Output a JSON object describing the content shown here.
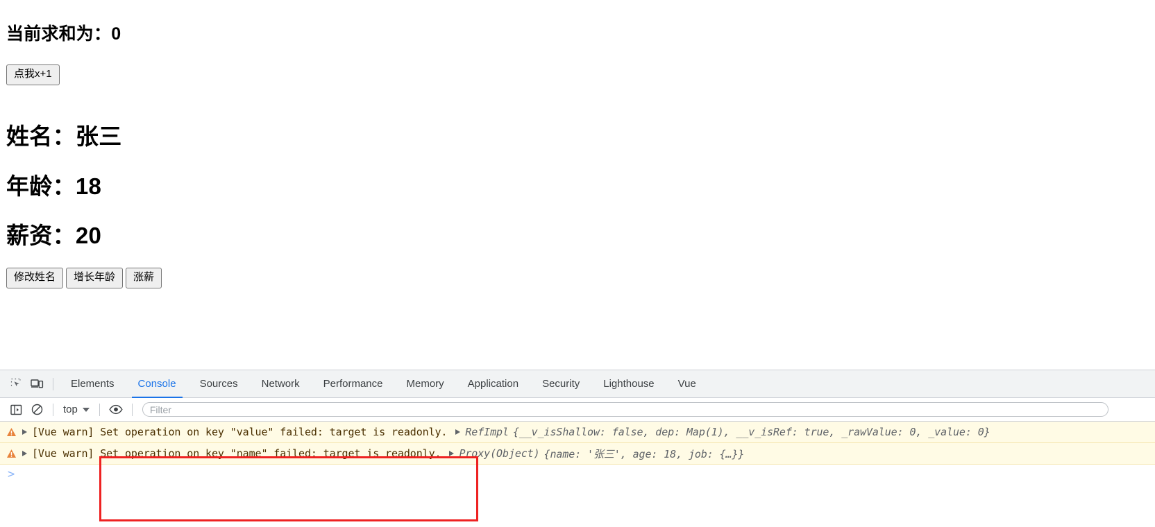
{
  "page": {
    "sum_heading": "当前求和为：0",
    "increment_button": "点我x+1",
    "name_heading": "姓名：张三",
    "age_heading": "年龄：18",
    "salary_heading": "薪资：20",
    "action_buttons": [
      {
        "label": "修改姓名",
        "name": "change-name-button"
      },
      {
        "label": "增长年龄",
        "name": "increase-age-button"
      },
      {
        "label": "涨薪",
        "name": "raise-salary-button"
      }
    ]
  },
  "devtools": {
    "icons": {
      "inspect": "inspect-element-icon",
      "device": "device-toolbar-icon",
      "sidebar": "console-sidebar-icon",
      "clear": "clear-console-icon",
      "eye": "live-expression-eye-icon"
    },
    "tabs": [
      {
        "label": "Elements",
        "active": false
      },
      {
        "label": "Console",
        "active": true
      },
      {
        "label": "Sources",
        "active": false
      },
      {
        "label": "Network",
        "active": false
      },
      {
        "label": "Performance",
        "active": false
      },
      {
        "label": "Memory",
        "active": false
      },
      {
        "label": "Application",
        "active": false
      },
      {
        "label": "Security",
        "active": false
      },
      {
        "label": "Lighthouse",
        "active": false
      },
      {
        "label": "Vue",
        "active": false
      }
    ],
    "toolbar": {
      "context": "top",
      "filter_placeholder": "Filter",
      "filter_value": ""
    },
    "messages": [
      {
        "level": "warning",
        "text": "[Vue warn] Set operation on key \"value\" failed: target is readonly.",
        "object": {
          "ctor": "RefImpl",
          "preview": "{__v_isShallow: false, dep: Map(1), __v_isRef: true, _rawValue: 0, _value: 0}",
          "parts": [
            {
              "t": "{",
              "k": "punct"
            },
            {
              "t": "__v_isShallow:",
              "k": "key"
            },
            {
              "t": "false",
              "k": "bool"
            },
            {
              "t": ",",
              "k": "punct"
            },
            {
              "t": "dep:",
              "k": "key"
            },
            {
              "t": "Map(1)",
              "k": "ctor"
            },
            {
              "t": ",",
              "k": "punct"
            },
            {
              "t": "__v_isRef:",
              "k": "key"
            },
            {
              "t": "true",
              "k": "bool"
            },
            {
              "t": ",",
              "k": "punct"
            },
            {
              "t": "_rawValue:",
              "k": "key"
            },
            {
              "t": "0",
              "k": "num"
            },
            {
              "t": ",",
              "k": "punct"
            },
            {
              "t": "_value:",
              "k": "key"
            },
            {
              "t": "0",
              "k": "num"
            },
            {
              "t": "}",
              "k": "punct"
            }
          ]
        }
      },
      {
        "level": "warning",
        "text": "[Vue warn] Set operation on key \"name\" failed: target is readonly.",
        "object": {
          "ctor": "Proxy(Object)",
          "preview": "{name: '张三', age: 18, job: {…}}",
          "parts": [
            {
              "t": "{",
              "k": "punct"
            },
            {
              "t": "name:",
              "k": "key"
            },
            {
              "t": "'张三'",
              "k": "str"
            },
            {
              "t": ",",
              "k": "punct"
            },
            {
              "t": "age:",
              "k": "key"
            },
            {
              "t": "18",
              "k": "num"
            },
            {
              "t": ",",
              "k": "punct"
            },
            {
              "t": "job:",
              "k": "key"
            },
            {
              "t": "{…}}",
              "k": "punct"
            }
          ]
        }
      }
    ],
    "prompt_caret": ">"
  },
  "colors": {
    "accent": "#1a73e8",
    "warning_bg": "#fffbe5",
    "warning_icon": "#e8833a",
    "annotation": "#ee2222"
  }
}
